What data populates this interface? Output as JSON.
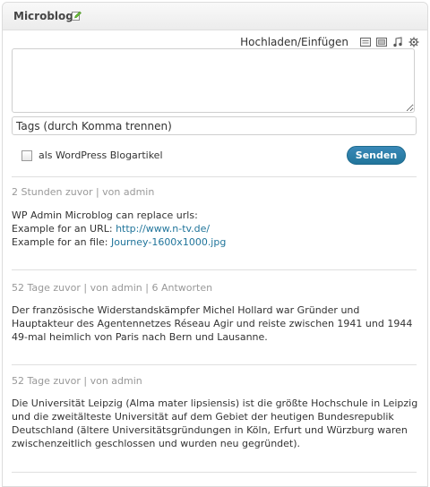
{
  "widget": {
    "title": "Microblog"
  },
  "form": {
    "media_label": "Hochladen/Einfügen",
    "media_icons": [
      "image-icon",
      "video-icon",
      "audio-icon",
      "media-icon"
    ],
    "content_value": "",
    "tags_placeholder": "Tags (durch Komma trennen)",
    "wp_checkbox_label": "als WordPress Blogartikel",
    "wp_checkbox_checked": false,
    "send_label": "Senden"
  },
  "posts": [
    {
      "meta": "2 Stunden zuvor | von admin",
      "line1": "WP Admin Microblog can replace urls:",
      "line2_prefix": "Example for an URL: ",
      "line2_link": "http://www.n-tv.de/",
      "line3_prefix": "Example for an file: ",
      "line3_link": "Journey-1600x1000.jpg"
    },
    {
      "meta": "52 Tage zuvor | von admin | 6 Antworten",
      "text": "Der französische Widerstandskämpfer Michel Hollard war Gründer und Hauptakteur des Agentennetzes Réseau Agir und reiste zwischen 1941 und 1944 49-mal heimlich von Paris nach Bern und Lausanne."
    },
    {
      "meta": "52 Tage zuvor | von admin",
      "text": "Die Universität Leipzig (Alma mater lipsiensis) ist die größte Hochschule in Leipzig und die zweitälteste Universität auf dem Gebiet der heutigen Bundesrepublik Deutschland (ältere Universitätsgründungen in Köln, Erfurt und Würzburg waren zwischenzeitlich geschlossen und wurden neu gegründet)."
    }
  ],
  "colors": {
    "accent": "#21759b",
    "meta": "#999999",
    "border": "#dfdfdf"
  }
}
